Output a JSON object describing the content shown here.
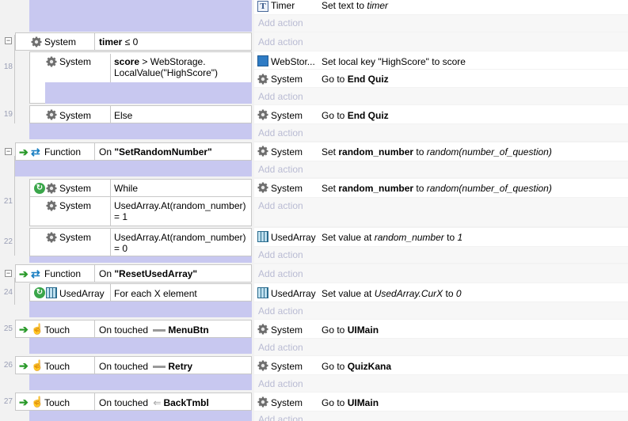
{
  "add_action_label": "Add action",
  "rows": {
    "r0": {
      "obj": "Timer",
      "text_pre": "Set text to ",
      "text_it": "timer"
    },
    "r1": {
      "obj": "System",
      "cond_b": "timer",
      "cond_rest": " ≤ 0"
    },
    "r18": {
      "num": "18",
      "obj": "System",
      "cond_b": "score",
      "cond_rest": " > WebStorage. LocalValue(\"HighScore\")",
      "a1_obj": "WebStor...",
      "a1_text": "Set local key \"HighScore\" to score",
      "a2_obj": "System",
      "a2_pre": "Go to ",
      "a2_b": "End Quiz"
    },
    "r19": {
      "num": "19",
      "obj": "System",
      "cond": "Else",
      "a_obj": "System",
      "a_pre": "Go to ",
      "a_b": "End Quiz"
    },
    "f1": {
      "obj": "Function",
      "pre": "On ",
      "b": "\"SetRandomNumber\"",
      "a_obj": "System",
      "a_pre": "Set ",
      "a_b": "random_number",
      "a_mid": " to ",
      "a_it": "random(number_of_question)"
    },
    "r21": {
      "num": "21",
      "obj1": "System",
      "cond1": "While",
      "obj2": "System",
      "cond2": "UsedArray.At(random_number) = 1",
      "a_obj": "System",
      "a_pre": "Set ",
      "a_b": "random_number",
      "a_mid": " to ",
      "a_it": "random(number_of_question)"
    },
    "r22": {
      "num": "22",
      "obj": "System",
      "cond": "UsedArray.At(random_number) = 0",
      "a_obj": "UsedArray",
      "a_pre": "Set value at ",
      "a_it": "random_number",
      "a_mid": " to ",
      "a_it2": "1"
    },
    "f2": {
      "obj": "Function",
      "pre": "On ",
      "b": "\"ResetUsedArray\""
    },
    "r24": {
      "num": "24",
      "obj": "UsedArray",
      "cond": "For each X element",
      "a_obj": "UsedArray",
      "a_pre": "Set value at ",
      "a_it": "UsedArray.CurX",
      "a_mid": " to ",
      "a_it2": "0"
    },
    "r25": {
      "num": "25",
      "obj": "Touch",
      "pre": "On touched ",
      "b": "MenuBtn",
      "a_obj": "System",
      "a_pre": "Go to ",
      "a_b": "UIMain"
    },
    "r26": {
      "num": "26",
      "obj": "Touch",
      "pre": "On touched ",
      "b": "Retry",
      "a_obj": "System",
      "a_pre": "Go to ",
      "a_b": "QuizKana"
    },
    "r27": {
      "num": "27",
      "obj": "Touch",
      "pre": "On touched ",
      "b": "BackTmbl",
      "a_obj": "System",
      "a_pre": "Go to ",
      "a_b": "UIMain"
    }
  },
  "colors": {
    "lavender": "#c8c8f0",
    "add_action": "#b9bbd3",
    "line_number": "#9a9fb5"
  }
}
